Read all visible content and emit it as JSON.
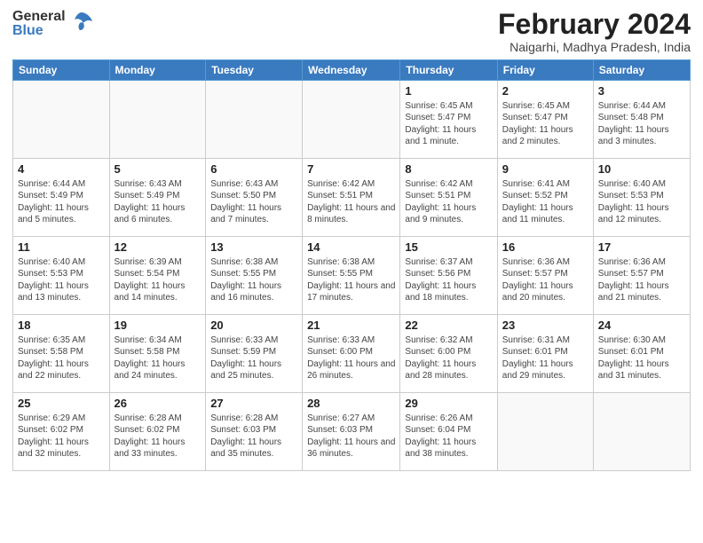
{
  "header": {
    "logo_general": "General",
    "logo_blue": "Blue",
    "month_year": "February 2024",
    "location": "Naigarhi, Madhya Pradesh, India"
  },
  "days_of_week": [
    "Sunday",
    "Monday",
    "Tuesday",
    "Wednesday",
    "Thursday",
    "Friday",
    "Saturday"
  ],
  "weeks": [
    [
      {
        "day": "",
        "info": ""
      },
      {
        "day": "",
        "info": ""
      },
      {
        "day": "",
        "info": ""
      },
      {
        "day": "",
        "info": ""
      },
      {
        "day": "1",
        "info": "Sunrise: 6:45 AM\nSunset: 5:47 PM\nDaylight: 11 hours and 1 minute."
      },
      {
        "day": "2",
        "info": "Sunrise: 6:45 AM\nSunset: 5:47 PM\nDaylight: 11 hours and 2 minutes."
      },
      {
        "day": "3",
        "info": "Sunrise: 6:44 AM\nSunset: 5:48 PM\nDaylight: 11 hours and 3 minutes."
      }
    ],
    [
      {
        "day": "4",
        "info": "Sunrise: 6:44 AM\nSunset: 5:49 PM\nDaylight: 11 hours and 5 minutes."
      },
      {
        "day": "5",
        "info": "Sunrise: 6:43 AM\nSunset: 5:49 PM\nDaylight: 11 hours and 6 minutes."
      },
      {
        "day": "6",
        "info": "Sunrise: 6:43 AM\nSunset: 5:50 PM\nDaylight: 11 hours and 7 minutes."
      },
      {
        "day": "7",
        "info": "Sunrise: 6:42 AM\nSunset: 5:51 PM\nDaylight: 11 hours and 8 minutes."
      },
      {
        "day": "8",
        "info": "Sunrise: 6:42 AM\nSunset: 5:51 PM\nDaylight: 11 hours and 9 minutes."
      },
      {
        "day": "9",
        "info": "Sunrise: 6:41 AM\nSunset: 5:52 PM\nDaylight: 11 hours and 11 minutes."
      },
      {
        "day": "10",
        "info": "Sunrise: 6:40 AM\nSunset: 5:53 PM\nDaylight: 11 hours and 12 minutes."
      }
    ],
    [
      {
        "day": "11",
        "info": "Sunrise: 6:40 AM\nSunset: 5:53 PM\nDaylight: 11 hours and 13 minutes."
      },
      {
        "day": "12",
        "info": "Sunrise: 6:39 AM\nSunset: 5:54 PM\nDaylight: 11 hours and 14 minutes."
      },
      {
        "day": "13",
        "info": "Sunrise: 6:38 AM\nSunset: 5:55 PM\nDaylight: 11 hours and 16 minutes."
      },
      {
        "day": "14",
        "info": "Sunrise: 6:38 AM\nSunset: 5:55 PM\nDaylight: 11 hours and 17 minutes."
      },
      {
        "day": "15",
        "info": "Sunrise: 6:37 AM\nSunset: 5:56 PM\nDaylight: 11 hours and 18 minutes."
      },
      {
        "day": "16",
        "info": "Sunrise: 6:36 AM\nSunset: 5:57 PM\nDaylight: 11 hours and 20 minutes."
      },
      {
        "day": "17",
        "info": "Sunrise: 6:36 AM\nSunset: 5:57 PM\nDaylight: 11 hours and 21 minutes."
      }
    ],
    [
      {
        "day": "18",
        "info": "Sunrise: 6:35 AM\nSunset: 5:58 PM\nDaylight: 11 hours and 22 minutes."
      },
      {
        "day": "19",
        "info": "Sunrise: 6:34 AM\nSunset: 5:58 PM\nDaylight: 11 hours and 24 minutes."
      },
      {
        "day": "20",
        "info": "Sunrise: 6:33 AM\nSunset: 5:59 PM\nDaylight: 11 hours and 25 minutes."
      },
      {
        "day": "21",
        "info": "Sunrise: 6:33 AM\nSunset: 6:00 PM\nDaylight: 11 hours and 26 minutes."
      },
      {
        "day": "22",
        "info": "Sunrise: 6:32 AM\nSunset: 6:00 PM\nDaylight: 11 hours and 28 minutes."
      },
      {
        "day": "23",
        "info": "Sunrise: 6:31 AM\nSunset: 6:01 PM\nDaylight: 11 hours and 29 minutes."
      },
      {
        "day": "24",
        "info": "Sunrise: 6:30 AM\nSunset: 6:01 PM\nDaylight: 11 hours and 31 minutes."
      }
    ],
    [
      {
        "day": "25",
        "info": "Sunrise: 6:29 AM\nSunset: 6:02 PM\nDaylight: 11 hours and 32 minutes."
      },
      {
        "day": "26",
        "info": "Sunrise: 6:28 AM\nSunset: 6:02 PM\nDaylight: 11 hours and 33 minutes."
      },
      {
        "day": "27",
        "info": "Sunrise: 6:28 AM\nSunset: 6:03 PM\nDaylight: 11 hours and 35 minutes."
      },
      {
        "day": "28",
        "info": "Sunrise: 6:27 AM\nSunset: 6:03 PM\nDaylight: 11 hours and 36 minutes."
      },
      {
        "day": "29",
        "info": "Sunrise: 6:26 AM\nSunset: 6:04 PM\nDaylight: 11 hours and 38 minutes."
      },
      {
        "day": "",
        "info": ""
      },
      {
        "day": "",
        "info": ""
      }
    ]
  ]
}
